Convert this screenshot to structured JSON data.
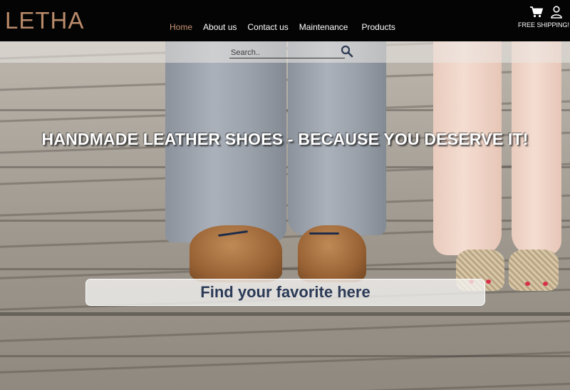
{
  "brand": {
    "logo": "LETHA",
    "logo_color": "#b98a6a",
    "accent_color": "#c79272"
  },
  "nav": {
    "items": [
      {
        "label": "Home",
        "active": true
      },
      {
        "label": "About us"
      },
      {
        "label": "Contact us"
      },
      {
        "label": "Maintenance"
      },
      {
        "label": "Products"
      }
    ]
  },
  "header_icons": {
    "cart": "cart-icon",
    "user": "user-icon",
    "shipping_label": "FREE SHIPPING!"
  },
  "search": {
    "placeholder": "Search..",
    "icon": "search-icon"
  },
  "hero": {
    "headline": "HANDMADE LEATHER SHOES - BECAUSE YOU DESERVE IT!",
    "cta_label": "Find your favorite here",
    "cta_text_color": "#2b3a57"
  }
}
